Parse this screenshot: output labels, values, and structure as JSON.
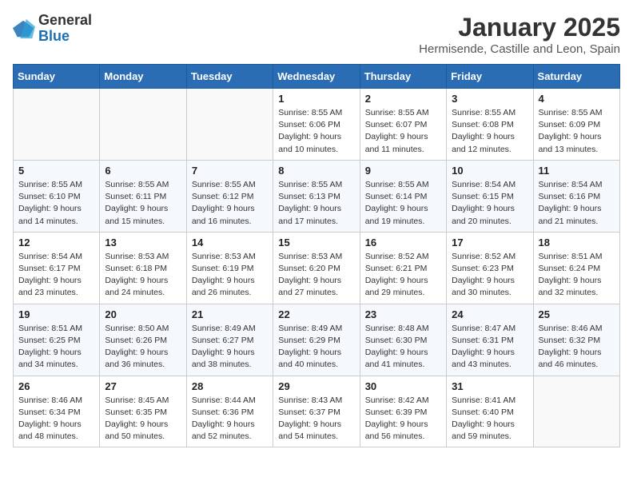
{
  "logo": {
    "general": "General",
    "blue": "Blue"
  },
  "header": {
    "month": "January 2025",
    "location": "Hermisende, Castille and Leon, Spain"
  },
  "weekdays": [
    "Sunday",
    "Monday",
    "Tuesday",
    "Wednesday",
    "Thursday",
    "Friday",
    "Saturday"
  ],
  "weeks": [
    [
      {
        "day": "",
        "info": ""
      },
      {
        "day": "",
        "info": ""
      },
      {
        "day": "",
        "info": ""
      },
      {
        "day": "1",
        "info": "Sunrise: 8:55 AM\nSunset: 6:06 PM\nDaylight: 9 hours\nand 10 minutes."
      },
      {
        "day": "2",
        "info": "Sunrise: 8:55 AM\nSunset: 6:07 PM\nDaylight: 9 hours\nand 11 minutes."
      },
      {
        "day": "3",
        "info": "Sunrise: 8:55 AM\nSunset: 6:08 PM\nDaylight: 9 hours\nand 12 minutes."
      },
      {
        "day": "4",
        "info": "Sunrise: 8:55 AM\nSunset: 6:09 PM\nDaylight: 9 hours\nand 13 minutes."
      }
    ],
    [
      {
        "day": "5",
        "info": "Sunrise: 8:55 AM\nSunset: 6:10 PM\nDaylight: 9 hours\nand 14 minutes."
      },
      {
        "day": "6",
        "info": "Sunrise: 8:55 AM\nSunset: 6:11 PM\nDaylight: 9 hours\nand 15 minutes."
      },
      {
        "day": "7",
        "info": "Sunrise: 8:55 AM\nSunset: 6:12 PM\nDaylight: 9 hours\nand 16 minutes."
      },
      {
        "day": "8",
        "info": "Sunrise: 8:55 AM\nSunset: 6:13 PM\nDaylight: 9 hours\nand 17 minutes."
      },
      {
        "day": "9",
        "info": "Sunrise: 8:55 AM\nSunset: 6:14 PM\nDaylight: 9 hours\nand 19 minutes."
      },
      {
        "day": "10",
        "info": "Sunrise: 8:54 AM\nSunset: 6:15 PM\nDaylight: 9 hours\nand 20 minutes."
      },
      {
        "day": "11",
        "info": "Sunrise: 8:54 AM\nSunset: 6:16 PM\nDaylight: 9 hours\nand 21 minutes."
      }
    ],
    [
      {
        "day": "12",
        "info": "Sunrise: 8:54 AM\nSunset: 6:17 PM\nDaylight: 9 hours\nand 23 minutes."
      },
      {
        "day": "13",
        "info": "Sunrise: 8:53 AM\nSunset: 6:18 PM\nDaylight: 9 hours\nand 24 minutes."
      },
      {
        "day": "14",
        "info": "Sunrise: 8:53 AM\nSunset: 6:19 PM\nDaylight: 9 hours\nand 26 minutes."
      },
      {
        "day": "15",
        "info": "Sunrise: 8:53 AM\nSunset: 6:20 PM\nDaylight: 9 hours\nand 27 minutes."
      },
      {
        "day": "16",
        "info": "Sunrise: 8:52 AM\nSunset: 6:21 PM\nDaylight: 9 hours\nand 29 minutes."
      },
      {
        "day": "17",
        "info": "Sunrise: 8:52 AM\nSunset: 6:23 PM\nDaylight: 9 hours\nand 30 minutes."
      },
      {
        "day": "18",
        "info": "Sunrise: 8:51 AM\nSunset: 6:24 PM\nDaylight: 9 hours\nand 32 minutes."
      }
    ],
    [
      {
        "day": "19",
        "info": "Sunrise: 8:51 AM\nSunset: 6:25 PM\nDaylight: 9 hours\nand 34 minutes."
      },
      {
        "day": "20",
        "info": "Sunrise: 8:50 AM\nSunset: 6:26 PM\nDaylight: 9 hours\nand 36 minutes."
      },
      {
        "day": "21",
        "info": "Sunrise: 8:49 AM\nSunset: 6:27 PM\nDaylight: 9 hours\nand 38 minutes."
      },
      {
        "day": "22",
        "info": "Sunrise: 8:49 AM\nSunset: 6:29 PM\nDaylight: 9 hours\nand 40 minutes."
      },
      {
        "day": "23",
        "info": "Sunrise: 8:48 AM\nSunset: 6:30 PM\nDaylight: 9 hours\nand 41 minutes."
      },
      {
        "day": "24",
        "info": "Sunrise: 8:47 AM\nSunset: 6:31 PM\nDaylight: 9 hours\nand 43 minutes."
      },
      {
        "day": "25",
        "info": "Sunrise: 8:46 AM\nSunset: 6:32 PM\nDaylight: 9 hours\nand 46 minutes."
      }
    ],
    [
      {
        "day": "26",
        "info": "Sunrise: 8:46 AM\nSunset: 6:34 PM\nDaylight: 9 hours\nand 48 minutes."
      },
      {
        "day": "27",
        "info": "Sunrise: 8:45 AM\nSunset: 6:35 PM\nDaylight: 9 hours\nand 50 minutes."
      },
      {
        "day": "28",
        "info": "Sunrise: 8:44 AM\nSunset: 6:36 PM\nDaylight: 9 hours\nand 52 minutes."
      },
      {
        "day": "29",
        "info": "Sunrise: 8:43 AM\nSunset: 6:37 PM\nDaylight: 9 hours\nand 54 minutes."
      },
      {
        "day": "30",
        "info": "Sunrise: 8:42 AM\nSunset: 6:39 PM\nDaylight: 9 hours\nand 56 minutes."
      },
      {
        "day": "31",
        "info": "Sunrise: 8:41 AM\nSunset: 6:40 PM\nDaylight: 9 hours\nand 59 minutes."
      },
      {
        "day": "",
        "info": ""
      }
    ]
  ]
}
